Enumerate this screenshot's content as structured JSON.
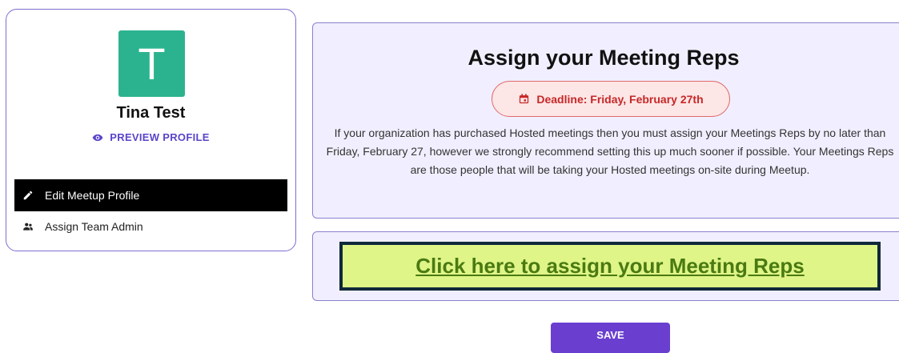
{
  "profile": {
    "avatar_letter": "T",
    "avatar_color": "#2bb38f",
    "name": "Tina Test",
    "preview_label": "PREVIEW PROFILE",
    "menu": [
      {
        "label": "Edit Meetup Profile",
        "icon": "pencil-icon",
        "active": true
      },
      {
        "label": "Assign Team Admin",
        "icon": "people-icon",
        "active": false
      }
    ]
  },
  "assign": {
    "title": "Assign your Meeting Reps",
    "deadline": "Deadline: Friday, February 27th",
    "deadline_icon": "calendar-icon",
    "description": "If your organization has purchased Hosted meetings then you must assign your Meetings Reps by no later than Friday, February 27, however we strongly recommend setting this up much sooner if possible. Your Meetings Reps are those people that will be taking your Hosted meetings on-site during Meetup.",
    "link_label": "Click here to assign your Meeting Reps"
  },
  "save_label": "SAVE",
  "colors": {
    "accent": "#6a3fd0",
    "panel_bg": "#f1efff",
    "deadline_red": "#c62828",
    "link_bg": "#dff587"
  }
}
